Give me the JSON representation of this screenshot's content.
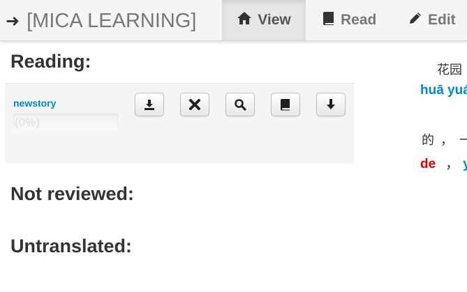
{
  "brand": {
    "icon": "arrow-right-icon",
    "title": "[MICA LEARNING]"
  },
  "nav": [
    {
      "label": "View",
      "icon": "home-icon",
      "active": true
    },
    {
      "label": "Read",
      "icon": "book-icon",
      "active": false
    },
    {
      "label": "Edit",
      "icon": "pencil-icon",
      "active": false
    }
  ],
  "sections": {
    "reading": "Reading:",
    "not_reviewed": "Not reviewed:",
    "untranslated": "Untranslated:"
  },
  "story": {
    "name": "newstory",
    "progress_percent": 0,
    "progress_label": "(0%)",
    "buttons": [
      "download-icon",
      "remove-icon",
      "search-icon",
      "book-icon",
      "arrow-down-icon"
    ]
  },
  "preview": {
    "line1_chars": "花园",
    "line1_pinyin": "huā yuá",
    "line2_chars": "的 ， 一",
    "line2_pinyin_red": "de",
    "line2_sep": "，",
    "line2_pinyin_blue": "y"
  },
  "colors": {
    "link": "#0088cc",
    "highlight": "#e00000",
    "navbar": "#f5f5f5"
  }
}
